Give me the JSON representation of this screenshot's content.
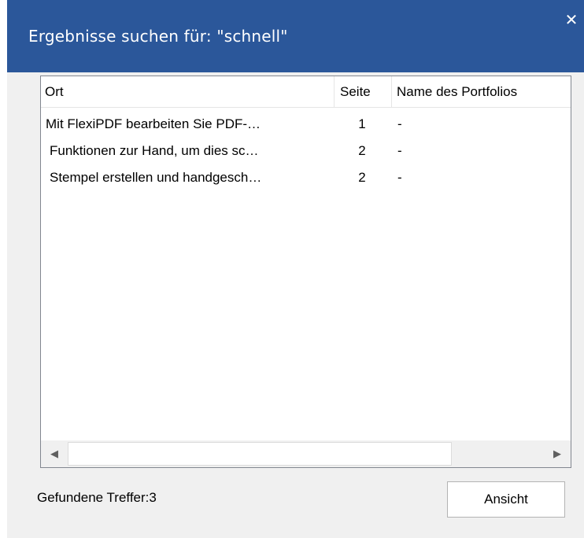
{
  "window": {
    "title": "Ergebnisse suchen für: \"schnell\"",
    "close_glyph": "✕",
    "titlebar_color": "#2b579a"
  },
  "results": {
    "columns": [
      "Ort",
      "Seite",
      "Name des Portfolios"
    ],
    "rows": [
      {
        "ort": "Mit FlexiPDF bearbeiten Sie PDF-…",
        "seite": "1",
        "portfolio": "-"
      },
      {
        "ort": "Funktionen zur Hand, um dies sc…",
        "seite": "2",
        "portfolio": "-"
      },
      {
        "ort": "Stempel erstellen und handgesch…",
        "seite": "2",
        "portfolio": "-"
      }
    ]
  },
  "scrollbar": {
    "left_arrow": "◀",
    "right_arrow": "▶"
  },
  "footer": {
    "status": "Gefundene Treffer:3",
    "view_button": "Ansicht"
  }
}
